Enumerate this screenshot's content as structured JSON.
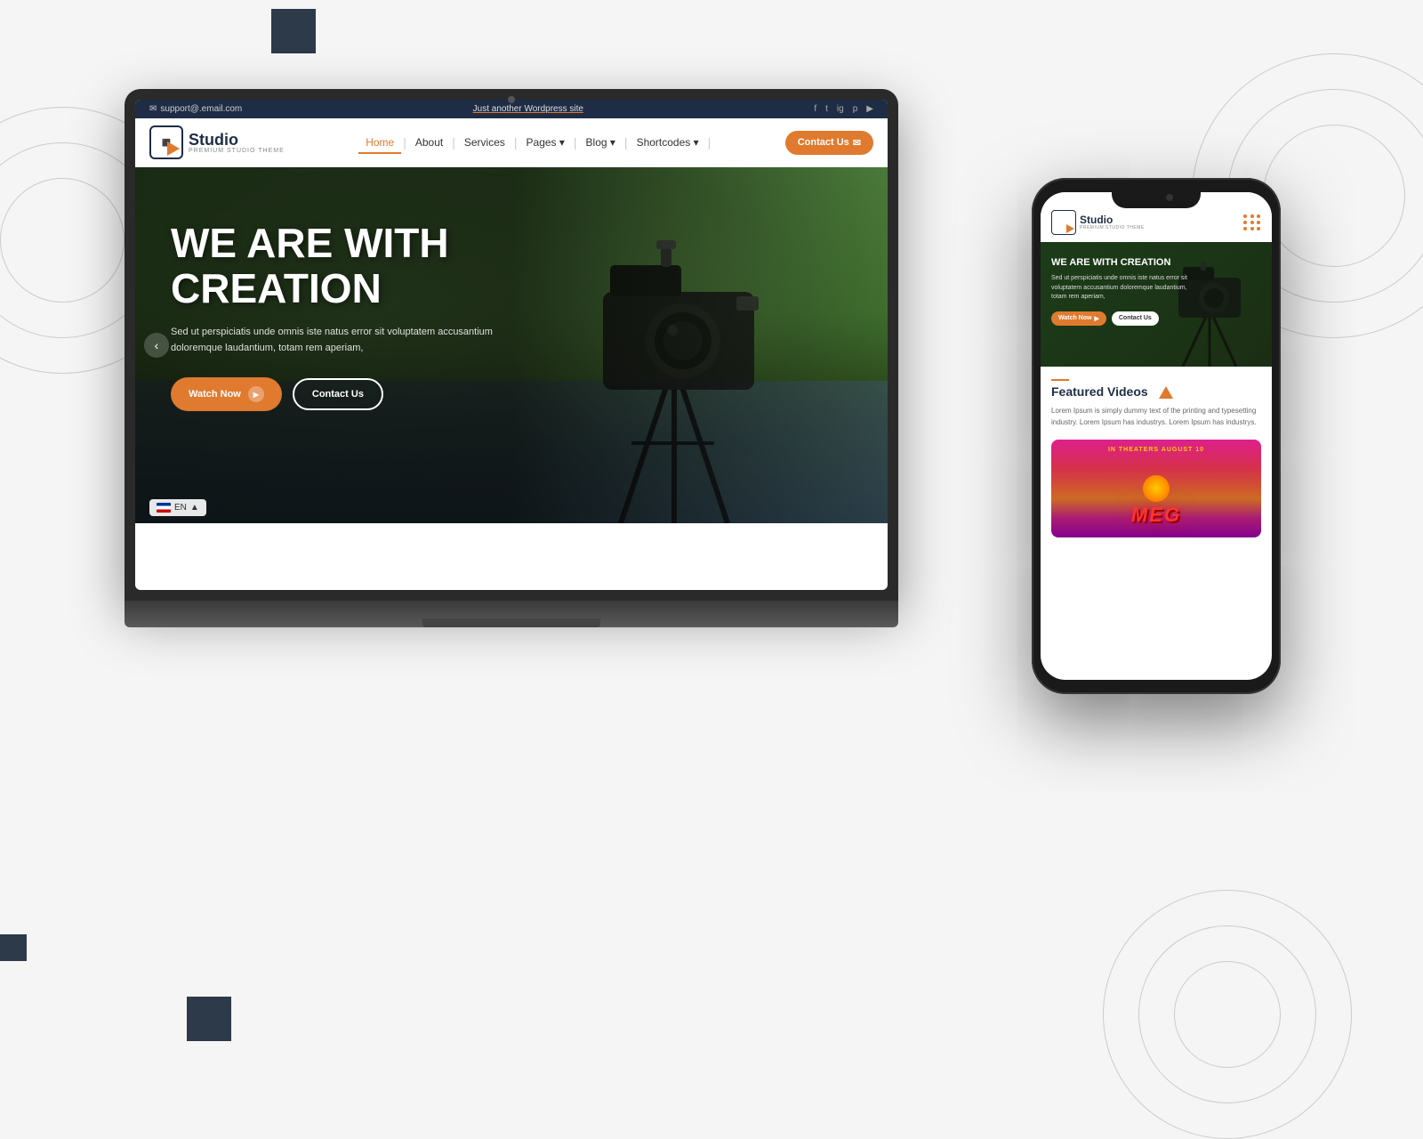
{
  "background": {
    "color": "#f5f5f5"
  },
  "laptop": {
    "topbar": {
      "email": "support@.email.com",
      "tagline": "Just another Wordpress site",
      "socials": [
        "f",
        "t",
        "ig",
        "p",
        "yt"
      ]
    },
    "nav": {
      "logo_name": "Studio",
      "logo_sub": "PREMIUM STUDIO THEME",
      "links": [
        {
          "label": "Home",
          "active": true
        },
        {
          "label": "About",
          "active": false
        },
        {
          "label": "Services",
          "active": false
        },
        {
          "label": "Pages",
          "has_dropdown": true
        },
        {
          "label": "Blog",
          "has_dropdown": true
        },
        {
          "label": "Shortcodes",
          "has_dropdown": true
        }
      ],
      "cta": "Contact Us"
    },
    "hero": {
      "title": "WE ARE WITH CREATION",
      "description": "Sed ut perspiciatis unde omnis iste natus error sit voluptatem accusantium doloremque laudantium, totam rem aperiam,",
      "watch_now": "Watch Now",
      "contact_us": "Contact Us",
      "lang": "EN"
    }
  },
  "phone": {
    "logo_name": "Studio",
    "logo_sub": "PREMIUM STUDIO THEME",
    "hero": {
      "title": "WE ARE WITH CREATION",
      "description": "Sed ut perspiciatis unde omnis iste natus error sit voluptatem accusantium doloremque laudantium, totam rem aperiam,",
      "watch_now": "Watch Now",
      "contact_us": "Contact Us"
    },
    "featured": {
      "title": "Featured Videos",
      "description": "Lorem Ipsum is simply dummy text of the printing and typesetting industry. Lorem Ipsum has industrys. Lorem Ipsum has industrys."
    },
    "movie": {
      "label": "IN THEATERS AUGUST 10",
      "title": "MEG"
    }
  }
}
